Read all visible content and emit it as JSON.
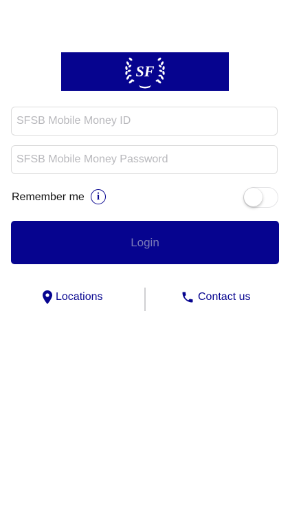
{
  "logo": {
    "monogram": "SF",
    "background_color": "#06048f"
  },
  "login_form": {
    "user_id_placeholder": "SFSB Mobile Money ID",
    "password_placeholder": "SFSB Mobile Money Password",
    "user_id_value": "",
    "password_value": "",
    "remember_me_label": "Remember me",
    "info_icon_glyph": "i",
    "remember_me_on": false,
    "login_label": "Login"
  },
  "footer_links": {
    "locations_label": "Locations",
    "locations_icon": "location-pin-icon",
    "contact_label": "Contact us",
    "contact_icon": "phone-icon"
  },
  "colors": {
    "accent": "#06048f",
    "login_text": "#7b7bb8",
    "placeholder": "#b8b8bc"
  }
}
